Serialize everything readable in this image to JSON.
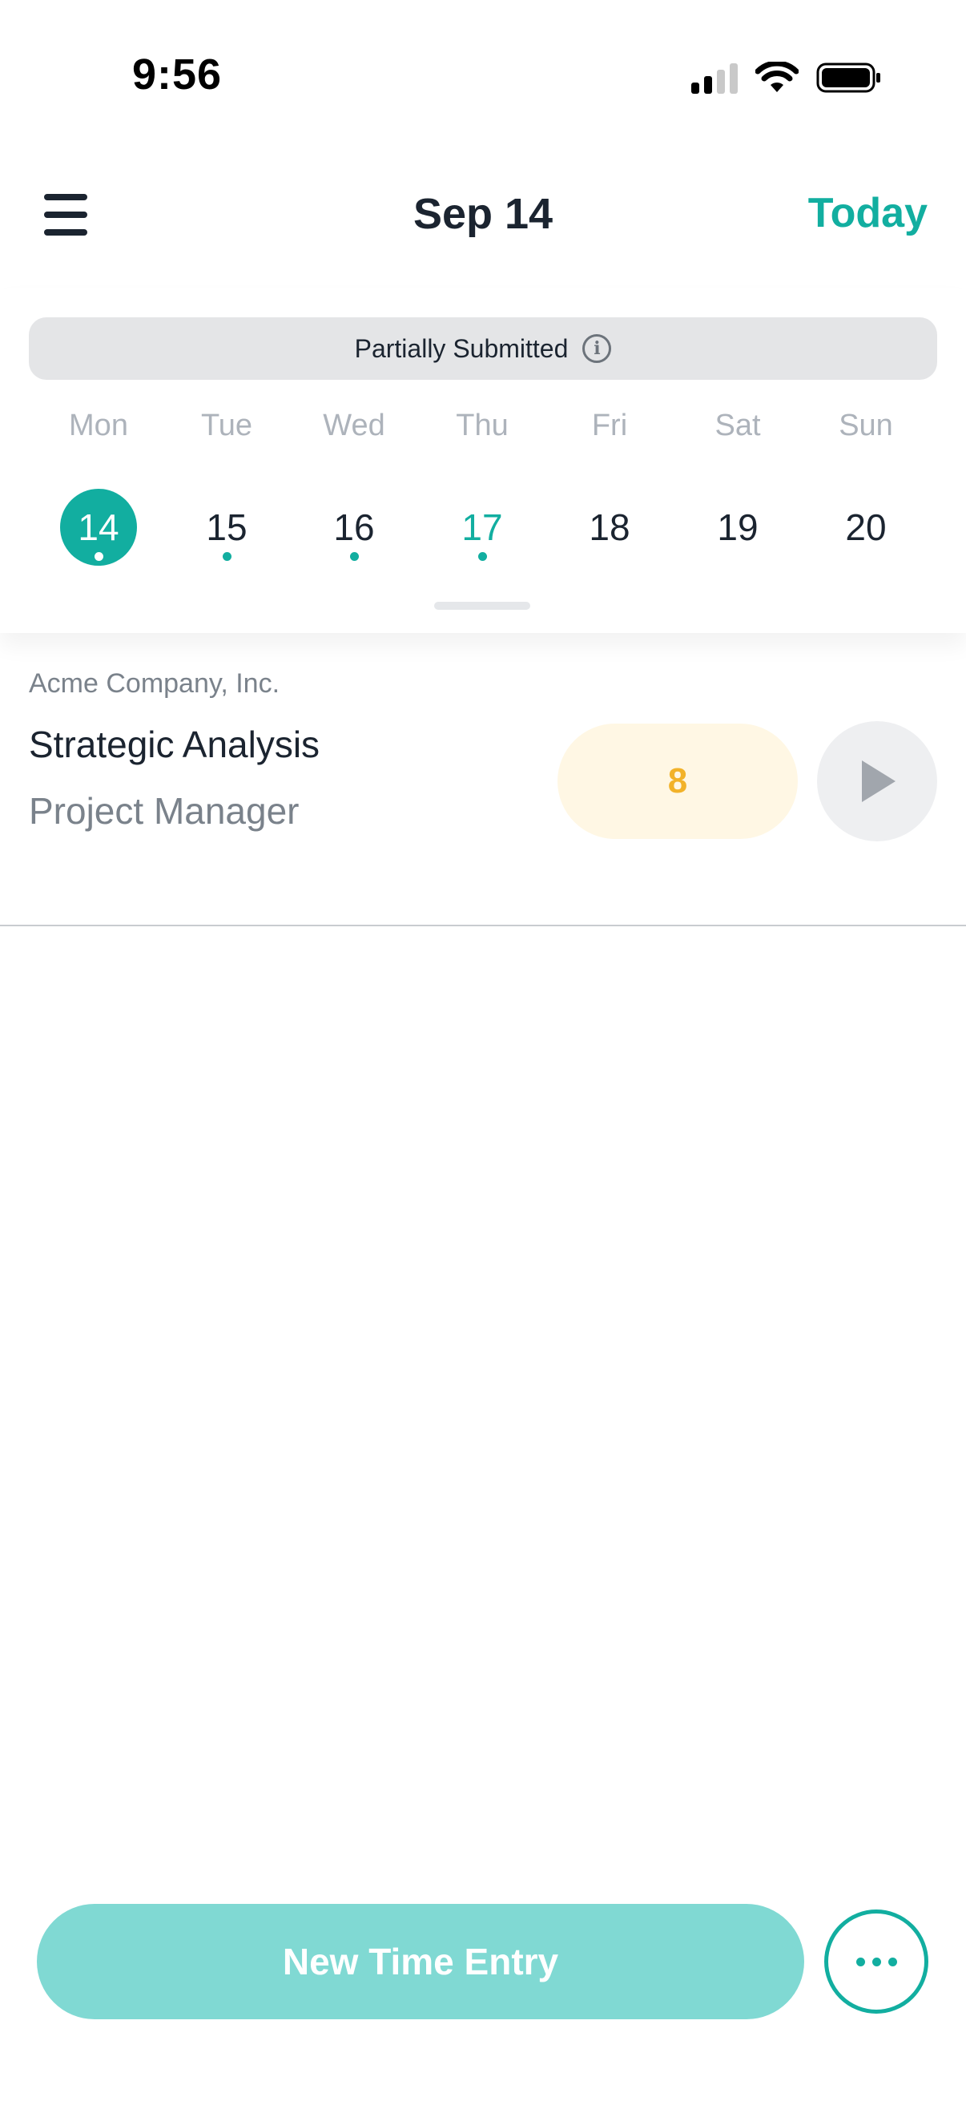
{
  "status_bar": {
    "time": "9:56"
  },
  "header": {
    "title": "Sep 14",
    "today_label": "Today"
  },
  "week": {
    "status_label": "Partially Submitted",
    "days": [
      {
        "name": "Mon",
        "num": "14"
      },
      {
        "name": "Tue",
        "num": "15"
      },
      {
        "name": "Wed",
        "num": "16"
      },
      {
        "name": "Thu",
        "num": "17"
      },
      {
        "name": "Fri",
        "num": "18"
      },
      {
        "name": "Sat",
        "num": "19"
      },
      {
        "name": "Sun",
        "num": "20"
      }
    ]
  },
  "entry": {
    "company": "Acme Company, Inc.",
    "task": "Strategic Analysis",
    "role": "Project Manager",
    "hours": "8"
  },
  "actions": {
    "new_entry_label": "New Time Entry"
  },
  "colors": {
    "accent": "#12aea0",
    "accent_light": "#80d9d3",
    "hours_text": "#f2b229",
    "hours_bg": "#fff7e4"
  },
  "icons": {
    "menu": "hamburger-menu-icon",
    "info": "info-icon",
    "play": "play-icon",
    "more": "more-dots-icon"
  }
}
